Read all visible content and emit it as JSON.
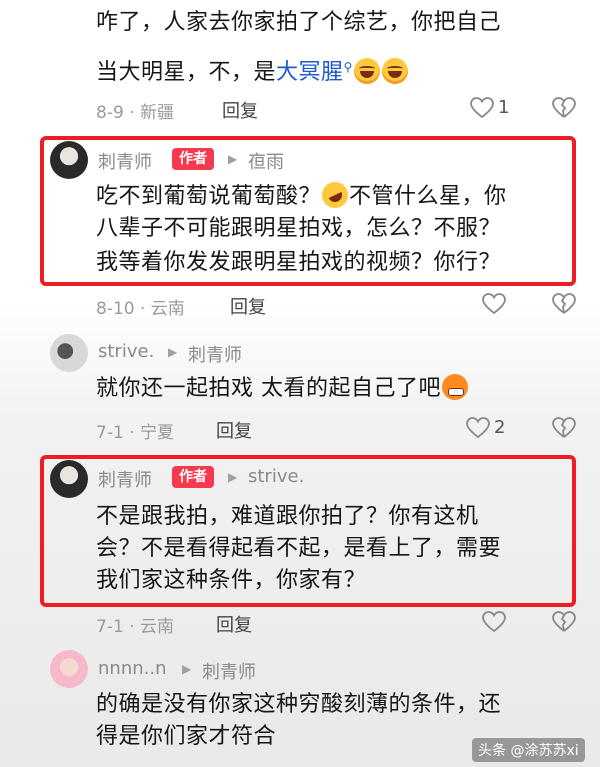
{
  "comment1": {
    "line1": "咋了，人家去你家拍了个综艺，你把自己",
    "line2_prefix": "当大明星，不，是",
    "line2_link": "大冥腥",
    "link_search_icon": "search-icon",
    "emojis": [
      "laugh-tears-emoji",
      "laugh-tears-emoji"
    ],
    "meta": "8-9 · 新疆",
    "reply": "回复",
    "likes": "1"
  },
  "reply1": {
    "author": "刺青师",
    "badge": "作者",
    "to": "亱雨",
    "line1_a": "吃不到葡萄说葡萄酸？",
    "line1_b": "不管什么星，你",
    "line2": "八辈子不可能跟明星拍戏，怎么？不服？",
    "line3": "我等着你发发跟明星拍戏的视频？你行？",
    "meta": "8-10 · 云南",
    "reply": "回复"
  },
  "reply2": {
    "author": "strive.",
    "to": "刺青师",
    "line1": "就你还一起拍戏 太看的起自己了吧",
    "meta": "7-1 · 宁夏",
    "reply": "回复",
    "likes": "2"
  },
  "reply3": {
    "author": "刺青师",
    "badge": "作者",
    "to": "strive.",
    "line1": "不是跟我拍，难道跟你拍了？你有这机",
    "line2": "会？不是看得起看不起，是看上了，需要",
    "line3": "我们家这种条件，你家有？",
    "meta": "7-1 · 云南",
    "reply": "回复"
  },
  "reply4": {
    "author": "nnnn..n",
    "to": "刺青师",
    "line1": "的确是没有你家这种穷酸刻薄的条件，还",
    "line2": "得是你们家才符合"
  },
  "watermark": "头条 @涂苏苏xi",
  "colors": {
    "highlight_border": "#ee1c25",
    "author_badge": "#f6394f",
    "link": "#1e5ac8"
  }
}
